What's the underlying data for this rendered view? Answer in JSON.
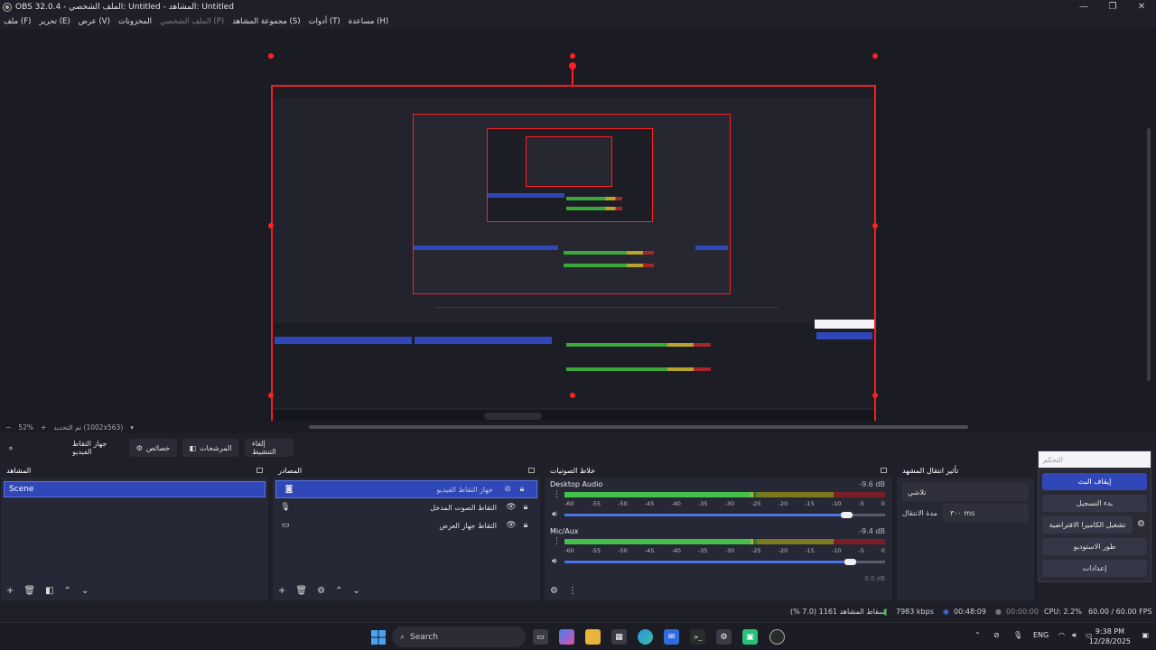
{
  "window": {
    "title": "OBS 32.0.4 - الملف الشخصي: Untitled - المشاهد: Untitled",
    "min_glyph": "—",
    "max_glyph": "❐",
    "close_glyph": "✕"
  },
  "menu": {
    "items": [
      "ملف (F)",
      "تحرير (E)",
      "عرض (V)",
      "المخزونات",
      "الملف الشخصي (P)",
      "مجموعة المشاهد (S)",
      "أدوات (T)",
      "مساعدة (H)"
    ]
  },
  "preview": {
    "zoom_minus": "−",
    "zoom_level": "52%",
    "zoom_plus": "+",
    "zoom_mode": "تم التحديد (1002x563)",
    "zoom_dropdown": "▾"
  },
  "toolbar": {
    "source_name": "جهاز التقاط الفيديو",
    "properties_label": "خصائص",
    "filters_label": "المرشحات",
    "deactivate_label": "إلغاء التنشيط"
  },
  "scenes": {
    "title": "المشاهد",
    "items": [
      "Scene"
    ]
  },
  "sources": {
    "title": "المصادر",
    "items": [
      {
        "name": "جهاز التقاط الفيديو",
        "icon": "camera-icon"
      },
      {
        "name": "التقاط الصوت المدخل",
        "icon": "microphone-icon"
      },
      {
        "name": "التقاط جهاز العرض",
        "icon": "monitor-icon"
      }
    ]
  },
  "mixer": {
    "title": "خلاط الصوتيات",
    "ticks": [
      "-60",
      "-55",
      "-50",
      "-45",
      "-40",
      "-35",
      "-30",
      "-25",
      "-20",
      "-15",
      "-10",
      "-5",
      "0"
    ],
    "channels": [
      {
        "name": "Desktop Audio",
        "db": "-9.6 dB",
        "level": 0.95,
        "volume": 0.88
      },
      {
        "name": "Mic/Aux",
        "db": "-9.4 dB",
        "level": 0.95,
        "volume": 0.89
      }
    ],
    "partial_db": "0.0 dB"
  },
  "transitions": {
    "title": "تأثير انتقال المشهد",
    "selected": "تلاشي",
    "duration_label": "مدة الانتقال",
    "duration_value": "٣٠٠ ms"
  },
  "controls": {
    "title": "التحكم",
    "stop_stream": "إيقاف البث",
    "start_recording": "بدء التسجيل",
    "virtual_camera": "تشغيل الكاميرا الافتراضية",
    "studio_mode": "طور الاستوديو",
    "settings": "إعدادات"
  },
  "status": {
    "dropped_frames": "إسقاط المشاهد 1161 (7.0 %)",
    "bitrate": "7983 kbps",
    "stream_time": "00:48:09",
    "rec_time": "00:00:00",
    "cpu": "CPU: 2.2%",
    "fps": "60.00 / 60.00 FPS"
  },
  "taskbar": {
    "search_placeholder": "Search",
    "language": "ENG",
    "time": "9:38 PM",
    "date": "12/28/2025",
    "tray_chevron": "⌃"
  },
  "colors": {
    "accent": "#2f47b8",
    "selection_border": "#ff1a1a",
    "meter_green": "#45c04a",
    "meter_yellow": "#c8b83a",
    "meter_red": "#a8252a"
  }
}
